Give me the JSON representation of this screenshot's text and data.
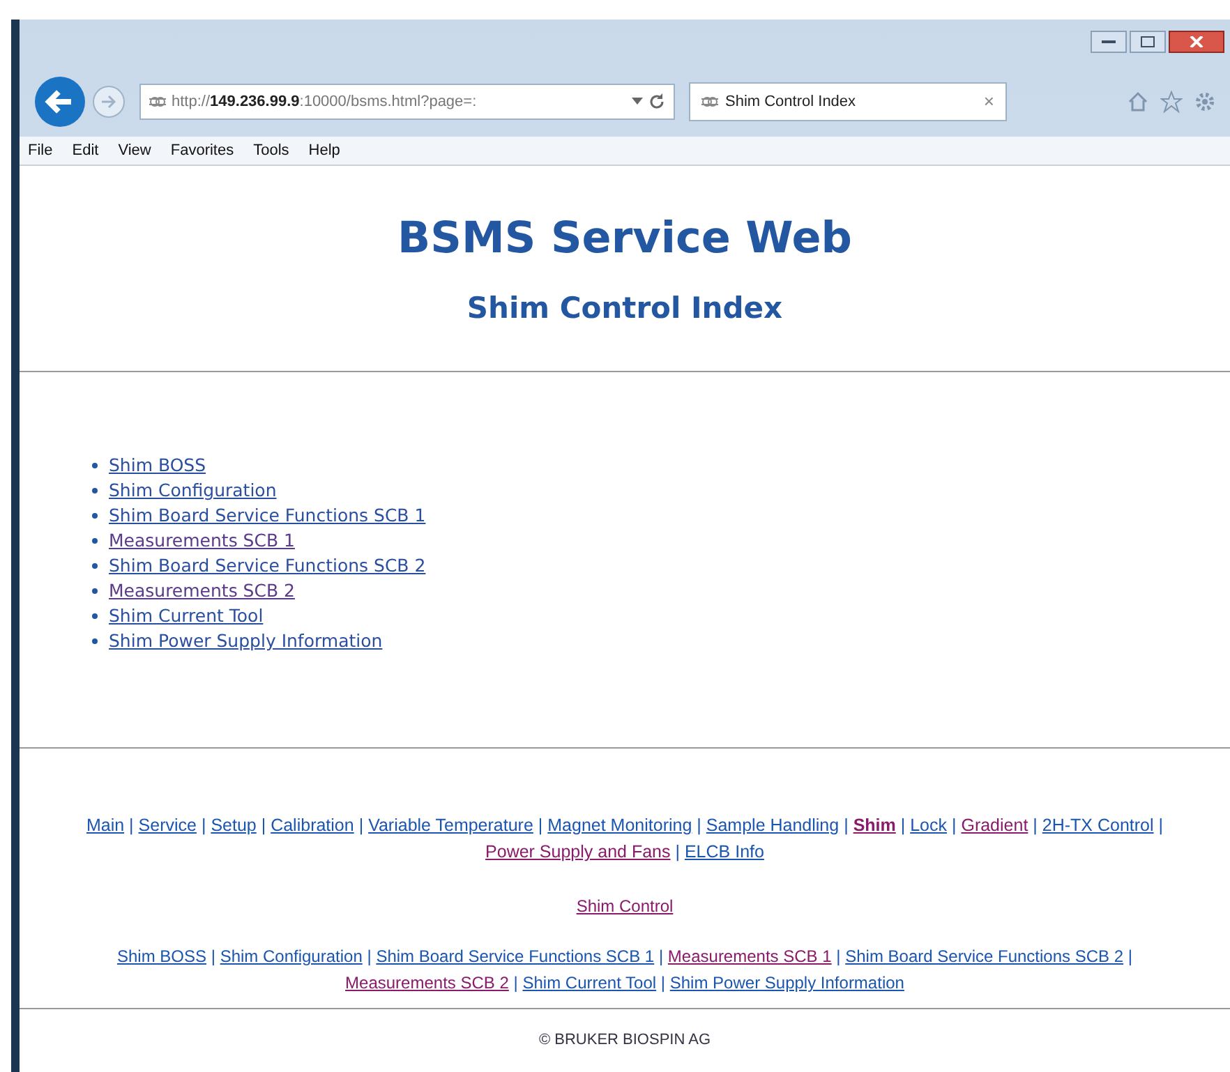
{
  "browser": {
    "address": {
      "prefix": "http://",
      "host": "149.236.99.9",
      "rest": ":10000/bsms.html?page=:"
    },
    "tab": {
      "title": "Shim Control Index",
      "close": "×"
    },
    "menu": [
      "File",
      "Edit",
      "View",
      "Favorites",
      "Tools",
      "Help"
    ]
  },
  "page": {
    "title": "BSMS Service Web",
    "subtitle": "Shim Control Index",
    "links": [
      {
        "text": "Shim BOSS",
        "visited": false
      },
      {
        "text": "Shim Configuration",
        "visited": false
      },
      {
        "text": "Shim Board Service Functions SCB 1",
        "visited": false
      },
      {
        "text": "Measurements SCB 1",
        "visited": true
      },
      {
        "text": "Shim Board Service Functions SCB 2",
        "visited": false
      },
      {
        "text": "Measurements SCB 2",
        "visited": true
      },
      {
        "text": "Shim Current Tool",
        "visited": false
      },
      {
        "text": "Shim Power Supply Information",
        "visited": false
      }
    ],
    "main_nav": [
      {
        "kind": "link",
        "text": "Main",
        "visited": false
      },
      {
        "kind": "sep",
        "text": "|"
      },
      {
        "kind": "link",
        "text": "Service",
        "visited": false
      },
      {
        "kind": "sep",
        "text": "|"
      },
      {
        "kind": "link",
        "text": "Setup",
        "visited": false
      },
      {
        "kind": "sep",
        "text": "|"
      },
      {
        "kind": "link",
        "text": "Calibration",
        "visited": false
      },
      {
        "kind": "sep",
        "text": "|"
      },
      {
        "kind": "link",
        "text": "Variable Temperature",
        "visited": false
      },
      {
        "kind": "sep",
        "text": "|"
      },
      {
        "kind": "link",
        "text": "Magnet Monitoring",
        "visited": false
      },
      {
        "kind": "sep",
        "text": "|"
      },
      {
        "kind": "link",
        "text": "Sample Handling",
        "visited": false
      },
      {
        "kind": "sep",
        "text": "|"
      },
      {
        "kind": "current",
        "text": "Shim",
        "visited": true
      },
      {
        "kind": "sep",
        "text": "|"
      },
      {
        "kind": "link",
        "text": "Lock",
        "visited": false
      },
      {
        "kind": "sep",
        "text": "|"
      },
      {
        "kind": "link",
        "text": "Gradient",
        "visited": true
      },
      {
        "kind": "sep",
        "text": "|"
      },
      {
        "kind": "link",
        "text": "2H-TX Control",
        "visited": false
      },
      {
        "kind": "sep",
        "text": "|"
      },
      {
        "kind": "link",
        "text": "Power Supply and Fans",
        "visited": true
      },
      {
        "kind": "sep",
        "text": "|"
      },
      {
        "kind": "link",
        "text": "ELCB Info",
        "visited": false
      }
    ],
    "section": {
      "text": "Shim Control",
      "visited": true
    },
    "sub_nav": [
      {
        "kind": "link",
        "text": "Shim BOSS",
        "visited": false
      },
      {
        "kind": "sep",
        "text": "|"
      },
      {
        "kind": "link",
        "text": "Shim Configuration",
        "visited": false
      },
      {
        "kind": "sep",
        "text": "|"
      },
      {
        "kind": "link",
        "text": "Shim Board Service Functions SCB 1",
        "visited": false
      },
      {
        "kind": "sep",
        "text": "|"
      },
      {
        "kind": "link",
        "text": "Measurements SCB 1",
        "visited": true
      },
      {
        "kind": "sep",
        "text": "|"
      },
      {
        "kind": "link",
        "text": "Shim Board Service Functions SCB 2",
        "visited": false
      },
      {
        "kind": "sep",
        "text": "|"
      },
      {
        "kind": "link",
        "text": "Measurements SCB 2",
        "visited": true
      },
      {
        "kind": "sep",
        "text": "|"
      },
      {
        "kind": "link",
        "text": "Shim Current Tool",
        "visited": false
      },
      {
        "kind": "sep",
        "text": "|"
      },
      {
        "kind": "link",
        "text": "Shim Power Supply Information",
        "visited": false
      }
    ],
    "footer": "© BRUKER BIOSPIN AG"
  }
}
